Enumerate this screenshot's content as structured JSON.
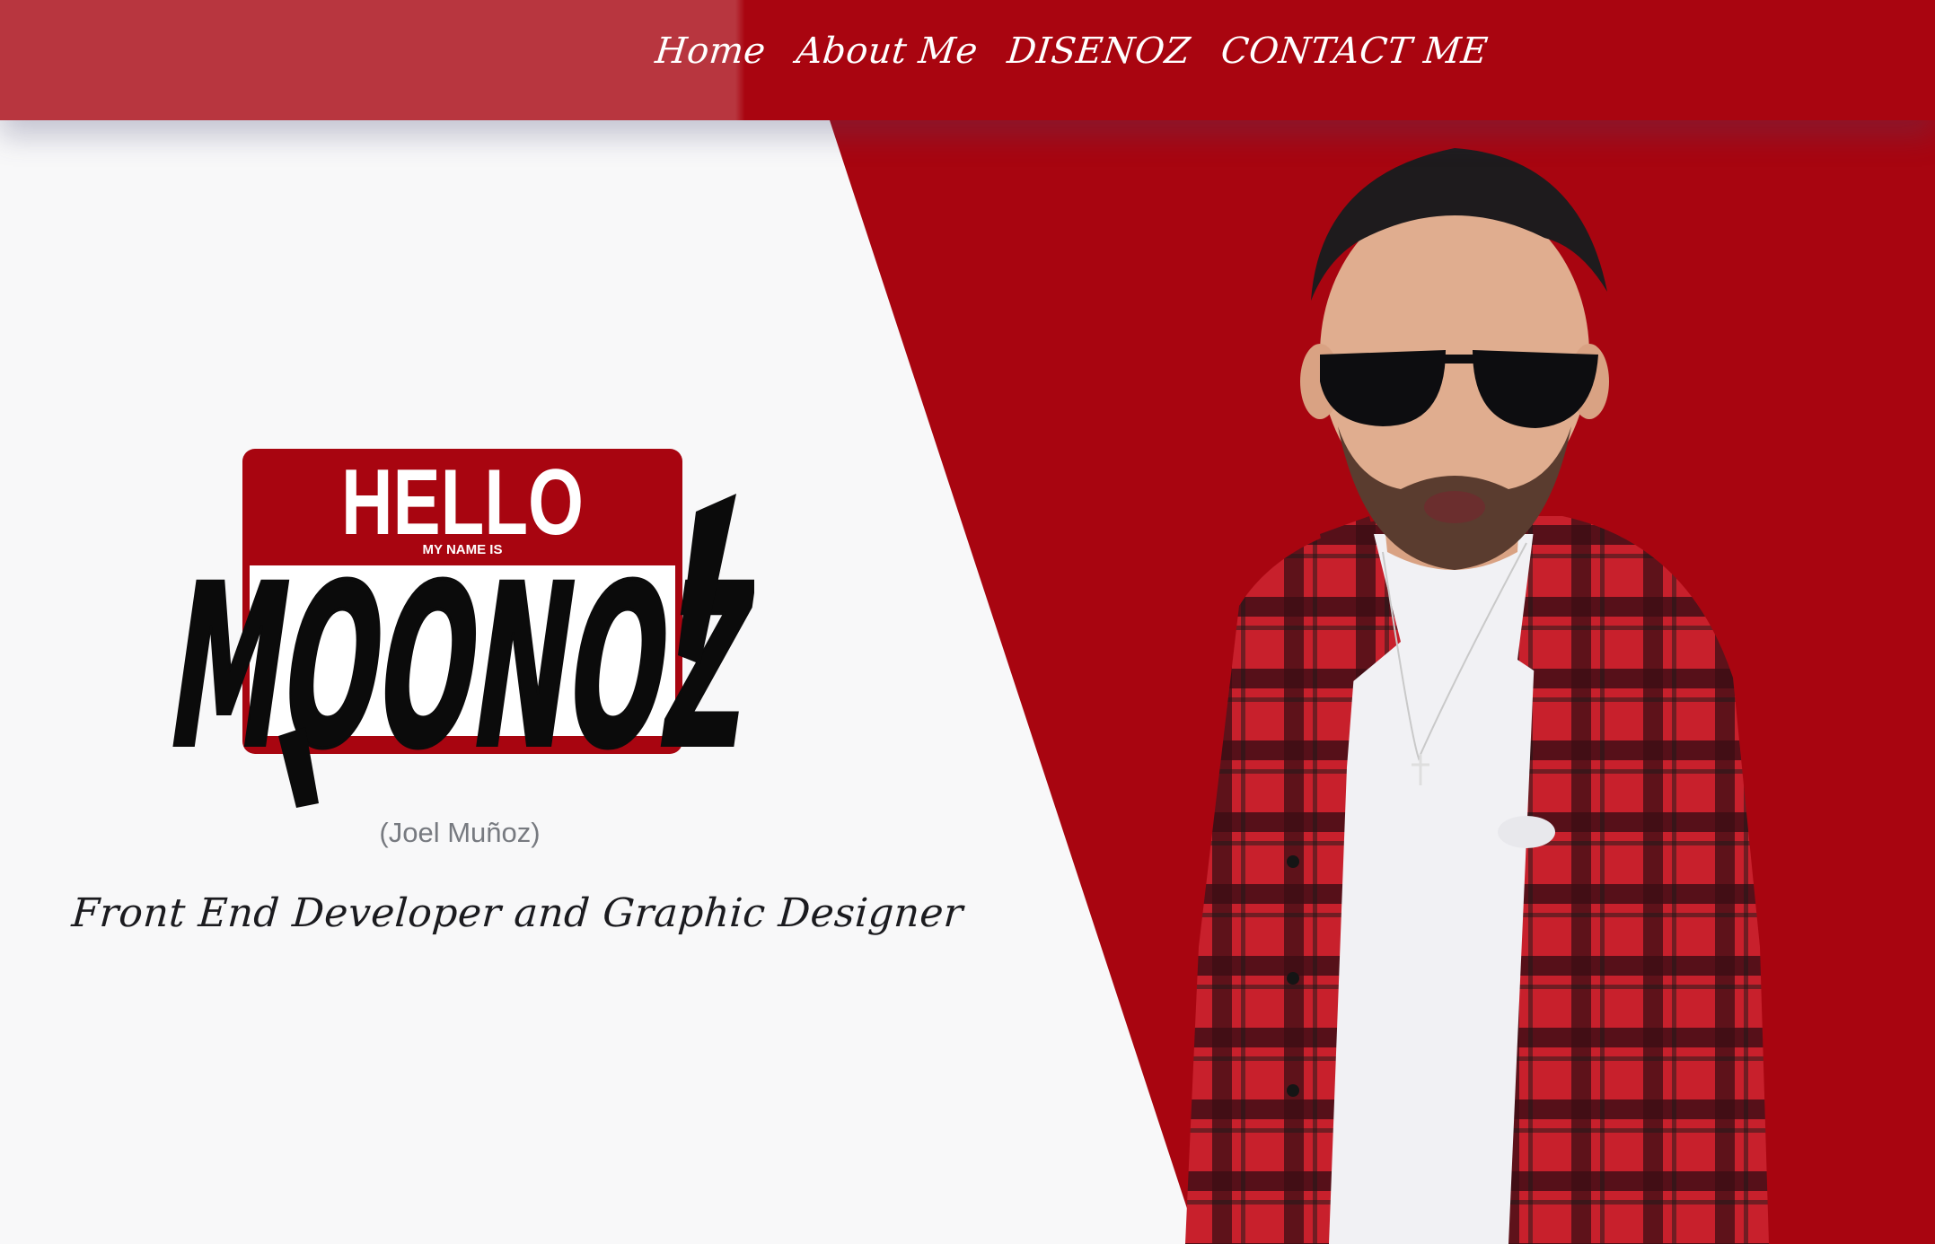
{
  "nav": {
    "items": [
      {
        "label": "Home"
      },
      {
        "label": "About Me"
      },
      {
        "label": "DISENOZ"
      },
      {
        "label": "CONTACT ME"
      }
    ]
  },
  "logo": {
    "badge_top": "HELLO",
    "badge_small": "MY NAME IS",
    "tag": "MOONOZ"
  },
  "hero": {
    "real_name": "(Joel Muñoz)",
    "tagline": "Front End Developer and Graphic Designer"
  },
  "colors": {
    "brand_red": "#a80510",
    "nav_light_red": "#b8363f",
    "background": "#f8f8f9",
    "text_dark": "#1b1b1f",
    "text_muted": "#777a80"
  }
}
